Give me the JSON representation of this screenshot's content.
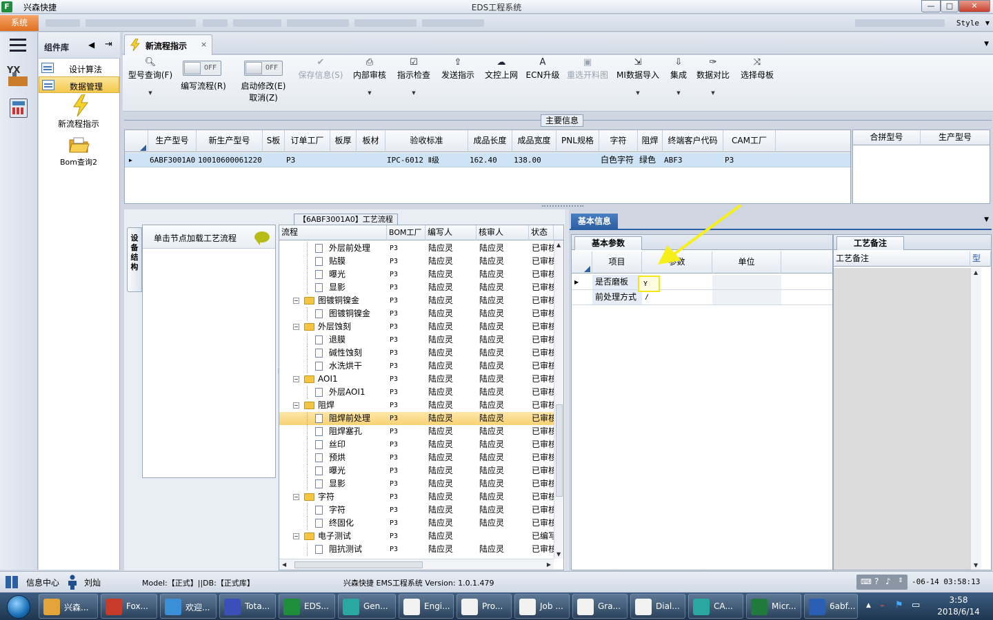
{
  "titlebar": {
    "app_name": "兴森快捷",
    "window_title": "EDS工程系统",
    "minimize": "—",
    "maximize": "□",
    "close": "✕"
  },
  "menubar": {
    "system_label": "系统",
    "style_label": "Style"
  },
  "component_library": {
    "title": "组件库",
    "items": [
      {
        "label": "设计算法"
      },
      {
        "label": "数据管理"
      }
    ],
    "big_items": [
      {
        "label": "新流程指示"
      },
      {
        "label": "Bom查询2"
      }
    ]
  },
  "doc_tab": {
    "label": "新流程指示",
    "close": "×"
  },
  "toolbar": {
    "model_query": "型号查询(F)",
    "edit_flow": "编写流程(R)",
    "edit_flow_toggle": "OFF",
    "enable_modify": "启动修改(E)",
    "enable_modify_toggle": "OFF",
    "cancel": "取消(Z)",
    "save_info": "保存信息(S)",
    "internal_review": "内部审核",
    "indicator_check": "指示检查",
    "send_indicator": "发送指示",
    "doc_upload": "文控上网",
    "ecn_upgrade": "ECN升级",
    "reselect_material": "重选开料图",
    "mi_import": "MI数据导入",
    "integrate": "集成",
    "data_compare": "数据对比",
    "select_master": "选择母板"
  },
  "main_info": {
    "title": "主要信息",
    "columns": [
      "生产型号",
      "新生产型号",
      "S板",
      "订单工厂",
      "板厚",
      "板材",
      "验收标准",
      "成品长度",
      "成品宽度",
      "PNL规格",
      "字符",
      "阻焊",
      "终端客户代码",
      "CAM工厂"
    ],
    "row": {
      "model": "6ABF3001A0",
      "new_model": "10010600061220",
      "s_board": "",
      "order_factory": "P3",
      "thickness": "",
      "material": "",
      "standard": "IPC-6012 Ⅱ级",
      "length": "162.40",
      "width": "138.00",
      "pnl": "",
      "char": "白色字符",
      "solder": "绿色",
      "customer": "ABF3",
      "cam": "P3"
    },
    "side_columns": [
      "合拼型号",
      "生产型号"
    ]
  },
  "process": {
    "title": "【6ABF3001A0】工艺流程",
    "device_tab": "设备结构",
    "node_hint": "单击节点加载工艺流程",
    "columns": [
      "流程",
      "BOM工厂",
      "编写人",
      "核审人",
      "状态"
    ],
    "rows": [
      {
        "name": "外层前处理",
        "level": 2,
        "type": "doc",
        "factory": "P3",
        "writer": "陆应灵",
        "reviewer": "陆应灵",
        "status": "已审核"
      },
      {
        "name": "贴膜",
        "level": 2,
        "type": "doc",
        "factory": "P3",
        "writer": "陆应灵",
        "reviewer": "陆应灵",
        "status": "已审核"
      },
      {
        "name": "曝光",
        "level": 2,
        "type": "doc",
        "factory": "P3",
        "writer": "陆应灵",
        "reviewer": "陆应灵",
        "status": "已审核"
      },
      {
        "name": "显影",
        "level": 2,
        "type": "doc",
        "factory": "P3",
        "writer": "陆应灵",
        "reviewer": "陆应灵",
        "status": "已审核"
      },
      {
        "name": "图镀铜镍金",
        "level": 1,
        "type": "folder",
        "factory": "P3",
        "writer": "陆应灵",
        "reviewer": "陆应灵",
        "status": "已审核"
      },
      {
        "name": "图镀铜镍金",
        "level": 2,
        "type": "doc",
        "factory": "P3",
        "writer": "陆应灵",
        "reviewer": "陆应灵",
        "status": "已审核"
      },
      {
        "name": "外层蚀刻",
        "level": 1,
        "type": "folder",
        "factory": "P3",
        "writer": "陆应灵",
        "reviewer": "陆应灵",
        "status": "已审核"
      },
      {
        "name": "退膜",
        "level": 2,
        "type": "doc",
        "factory": "P3",
        "writer": "陆应灵",
        "reviewer": "陆应灵",
        "status": "已审核"
      },
      {
        "name": "碱性蚀刻",
        "level": 2,
        "type": "doc",
        "factory": "P3",
        "writer": "陆应灵",
        "reviewer": "陆应灵",
        "status": "已审核"
      },
      {
        "name": "水洗烘干",
        "level": 2,
        "type": "doc",
        "factory": "P3",
        "writer": "陆应灵",
        "reviewer": "陆应灵",
        "status": "已审核"
      },
      {
        "name": "AOI1",
        "level": 1,
        "type": "folder",
        "factory": "P3",
        "writer": "陆应灵",
        "reviewer": "陆应灵",
        "status": "已审核"
      },
      {
        "name": "外层AOI1",
        "level": 2,
        "type": "doc",
        "factory": "P3",
        "writer": "陆应灵",
        "reviewer": "陆应灵",
        "status": "已审核"
      },
      {
        "name": "阻焊",
        "level": 1,
        "type": "folder",
        "factory": "P3",
        "writer": "陆应灵",
        "reviewer": "陆应灵",
        "status": "已审核"
      },
      {
        "name": "阻焊前处理",
        "level": 2,
        "type": "doc",
        "factory": "P3",
        "writer": "陆应灵",
        "reviewer": "陆应灵",
        "status": "已审核",
        "selected": true
      },
      {
        "name": "阻焊塞孔",
        "level": 2,
        "type": "doc",
        "factory": "P3",
        "writer": "陆应灵",
        "reviewer": "陆应灵",
        "status": "已审核"
      },
      {
        "name": "丝印",
        "level": 2,
        "type": "doc",
        "factory": "P3",
        "writer": "陆应灵",
        "reviewer": "陆应灵",
        "status": "已审核"
      },
      {
        "name": "预烘",
        "level": 2,
        "type": "doc",
        "factory": "P3",
        "writer": "陆应灵",
        "reviewer": "陆应灵",
        "status": "已审核"
      },
      {
        "name": "曝光",
        "level": 2,
        "type": "doc",
        "factory": "P3",
        "writer": "陆应灵",
        "reviewer": "陆应灵",
        "status": "已审核"
      },
      {
        "name": "显影",
        "level": 2,
        "type": "doc",
        "factory": "P3",
        "writer": "陆应灵",
        "reviewer": "陆应灵",
        "status": "已审核"
      },
      {
        "name": "字符",
        "level": 1,
        "type": "folder",
        "factory": "P3",
        "writer": "陆应灵",
        "reviewer": "陆应灵",
        "status": "已审核"
      },
      {
        "name": "字符",
        "level": 2,
        "type": "doc",
        "factory": "P3",
        "writer": "陆应灵",
        "reviewer": "陆应灵",
        "status": "已审核"
      },
      {
        "name": "终固化",
        "level": 2,
        "type": "doc",
        "factory": "P3",
        "writer": "陆应灵",
        "reviewer": "陆应灵",
        "status": "已审核"
      },
      {
        "name": "电子测试",
        "level": 1,
        "type": "folder",
        "factory": "P3",
        "writer": "陆应灵",
        "reviewer": "",
        "status": "已编写"
      },
      {
        "name": "阻抗测试",
        "level": 2,
        "type": "doc",
        "factory": "P3",
        "writer": "陆应灵",
        "reviewer": "陆应灵",
        "status": "已审核"
      }
    ]
  },
  "basic_info": {
    "tab": "基本信息",
    "params_tab": "基本参数",
    "columns": [
      "项目",
      "参数",
      "单位"
    ],
    "rows": [
      {
        "item": "是否磨板",
        "value": "Y",
        "unit": ""
      },
      {
        "item": "前处理方式",
        "value": "/",
        "unit": ""
      }
    ],
    "notes_tab": "工艺备注",
    "notes_columns": [
      "工艺备注",
      "型"
    ]
  },
  "statusbar": {
    "message_center": "信息中心",
    "user": "刘灿",
    "model_db": "Model:【正式】||DB:【正式库】",
    "version": "兴森快捷 EMS工程系统 Version: 1.0.1.479",
    "datetime": "-06-14 03:58:13"
  },
  "taskbar": {
    "apps": [
      {
        "label": "兴森...",
        "color": "#e3a43a"
      },
      {
        "label": "Fox...",
        "color": "#c83a2a"
      },
      {
        "label": "欢迎...",
        "color": "#3a8fd8"
      },
      {
        "label": "Tota...",
        "color": "#3b4fb8"
      },
      {
        "label": "EDS...",
        "color": "#1e8d3c"
      },
      {
        "label": "Gen...",
        "color": "#2aa7a0"
      },
      {
        "label": "Engi...",
        "color": "#f2f2f2"
      },
      {
        "label": "Pro...",
        "color": "#f2f2f2"
      },
      {
        "label": "Job ...",
        "color": "#f2f2f2"
      },
      {
        "label": "Gra...",
        "color": "#f2f2f2"
      },
      {
        "label": "Dial...",
        "color": "#f2f2f2"
      },
      {
        "label": "CA...",
        "color": "#2aa7a0"
      },
      {
        "label": "Micr...",
        "color": "#1f7a3c"
      },
      {
        "label": "6abf...",
        "color": "#2b5fb3"
      }
    ],
    "clock_time": "3:58",
    "clock_date": "2018/6/14"
  }
}
